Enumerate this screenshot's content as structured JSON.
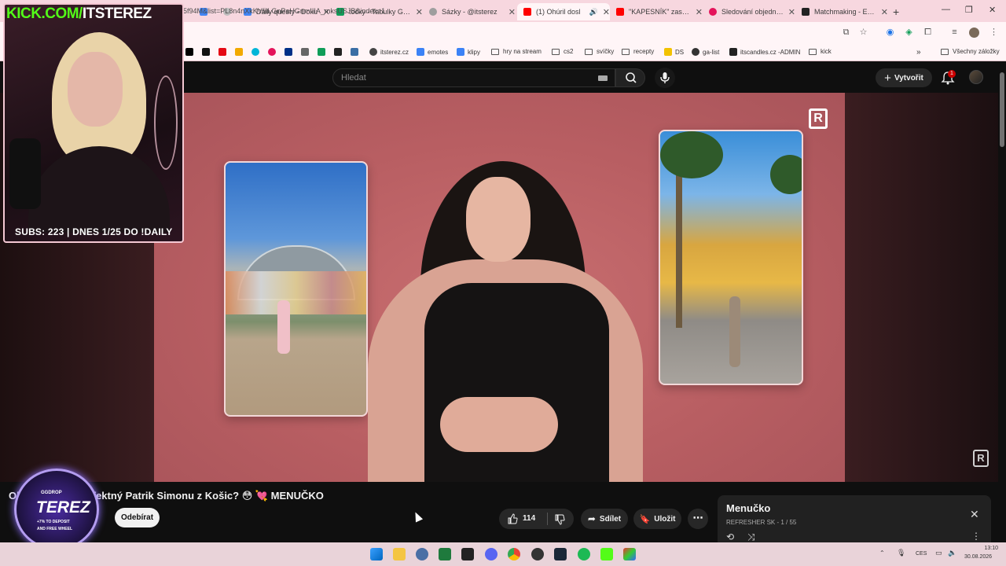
{
  "browser": {
    "tabs": [
      {
        "title": "Daily questy - Doku",
        "icon": "docs-icon",
        "color": "#4285f4"
      },
      {
        "title": "točky - Tabulky Goo",
        "icon": "sheets-icon",
        "color": "#0f9d58"
      },
      {
        "title": "Sázky - @itsterez",
        "icon": "globe-icon",
        "color": "#9e9e9e"
      },
      {
        "title": "(1) Ohúril dosl",
        "icon": "youtube-icon",
        "color": "#ff0000",
        "active": true
      },
      {
        "title": "\"KAPESNÍK\" zase ne",
        "icon": "youtube-icon",
        "color": "#ff0000"
      },
      {
        "title": "Sledování objednáv",
        "icon": "shop-icon",
        "color": "#e4145b"
      },
      {
        "title": "Matchmaking - Euro",
        "icon": "faceit-icon",
        "color": "#222222"
      }
    ],
    "url": "5f94M&list=PL8n4nXkKVfilLGnPaHGnmIIIA_mksUSJB&index=1",
    "bookmarks": [
      {
        "label": "itsterez.cz",
        "type": "site"
      },
      {
        "label": "emotes",
        "type": "site"
      },
      {
        "label": "klipy",
        "type": "site"
      },
      {
        "label": "hry na stream",
        "type": "folder"
      },
      {
        "label": "cs2",
        "type": "folder"
      },
      {
        "label": "svíčky",
        "type": "folder"
      },
      {
        "label": "recepty",
        "type": "folder"
      },
      {
        "label": "DS",
        "type": "site"
      },
      {
        "label": "ga-list",
        "type": "site"
      },
      {
        "label": "itscandles.cz -ADMIN",
        "type": "site"
      },
      {
        "label": "kick",
        "type": "folder"
      }
    ],
    "all_bookmarks": "Všechny záložky"
  },
  "youtube": {
    "search_placeholder": "Hledat",
    "create_label": "Vytvořit",
    "notification_count": "1",
    "video_title": "Oh… fektný Patrik Simonu z Košic? 😳 💘 MENUČKO",
    "video_title_visible": "fektný Patrik Simonu z Košic? 😳 💘 MENUČKO",
    "video_title_prefix": "Ol",
    "subscribe_label": "Odebírat",
    "like_count": "114",
    "share_label": "Sdílet",
    "save_label": "Uložit",
    "playlist": {
      "title": "Menučko",
      "channel": "REFRESHER SK",
      "position": "1 / 55"
    },
    "watermark": "R"
  },
  "overlay": {
    "kick_prefix": "KICK.COM/",
    "kick_name": "ITSTEREZ",
    "subs_text": "SUBS: 223 | DNES 1/25 DO !DAILY",
    "badge_brand": "GGDROP",
    "badge_name": "TEREZ",
    "badge_line1": "+7% TO DEPOSIT",
    "badge_line2": "AND FREE WHEEL"
  },
  "system": {
    "language": "CES",
    "time": "13:10",
    "date": "30.08.2026"
  },
  "colors": {
    "youtube_bg": "#0f0f0f",
    "kick_green": "#53fc18",
    "video_bg": "#c96f71",
    "badge_ring": "#b39cf0"
  }
}
